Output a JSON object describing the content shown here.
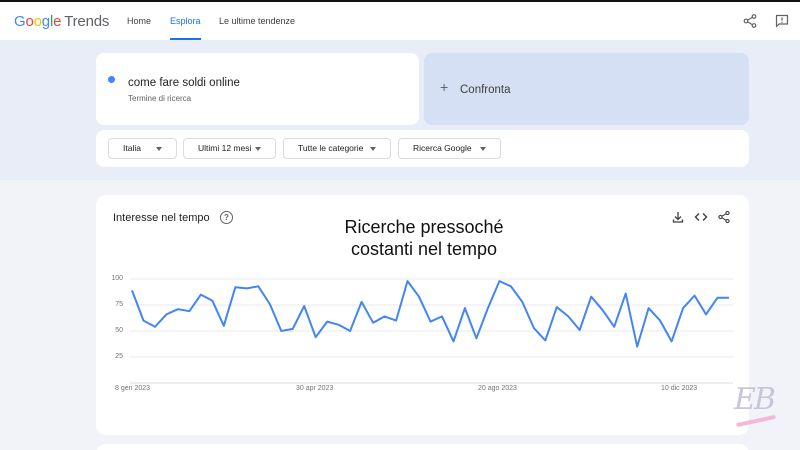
{
  "header": {
    "logo_google": "Google",
    "logo_trends": "Trends",
    "nav": [
      {
        "label": "Home",
        "active": false
      },
      {
        "label": "Esplora",
        "active": true
      },
      {
        "label": "Le ultime tendenze",
        "active": false
      }
    ],
    "icons": [
      "share-icon",
      "feedback-icon"
    ]
  },
  "search_term": {
    "name": "come fare soldi online",
    "type": "Termine di ricerca",
    "color": "#4285f4"
  },
  "compare": {
    "plus": "+",
    "label": "Confronta"
  },
  "filters": [
    {
      "label": "Italia"
    },
    {
      "label": "Ultimi 12 mesi"
    },
    {
      "label": "Tutte le categorie"
    },
    {
      "label": "Ricerca Google"
    }
  ],
  "chart_card": {
    "title": "Interesse nel tempo",
    "help_icon": "?",
    "icons": [
      "download-icon",
      "embed-icon",
      "share-icon"
    ],
    "overlay_line1": "Ricerche pressoché",
    "overlay_line2": "costanti nel tempo"
  },
  "chart_data": {
    "type": "line",
    "title": "Interesse nel tempo",
    "xlabel": "",
    "ylabel": "",
    "ylim": [
      0,
      100
    ],
    "y_ticks": [
      100,
      75,
      50,
      25
    ],
    "x_tick_labels": [
      "8 gen 2023",
      "30 apr 2023",
      "20 ago 2023",
      "10 dic 2023"
    ],
    "grid": true,
    "series_color": "#4285f4",
    "series": [
      {
        "values": [
          89,
          60,
          54,
          66,
          71,
          69,
          85,
          79,
          55,
          92,
          91,
          93,
          76,
          50,
          52,
          74,
          44,
          59,
          56,
          50,
          78,
          58,
          64,
          60,
          98,
          83,
          59,
          64,
          40,
          72,
          43,
          72,
          98,
          93,
          78,
          53,
          41,
          73,
          64,
          51,
          83,
          70,
          54,
          86,
          35,
          72,
          60,
          40,
          72,
          84,
          66,
          82,
          82
        ]
      }
    ]
  },
  "watermark": "EB"
}
